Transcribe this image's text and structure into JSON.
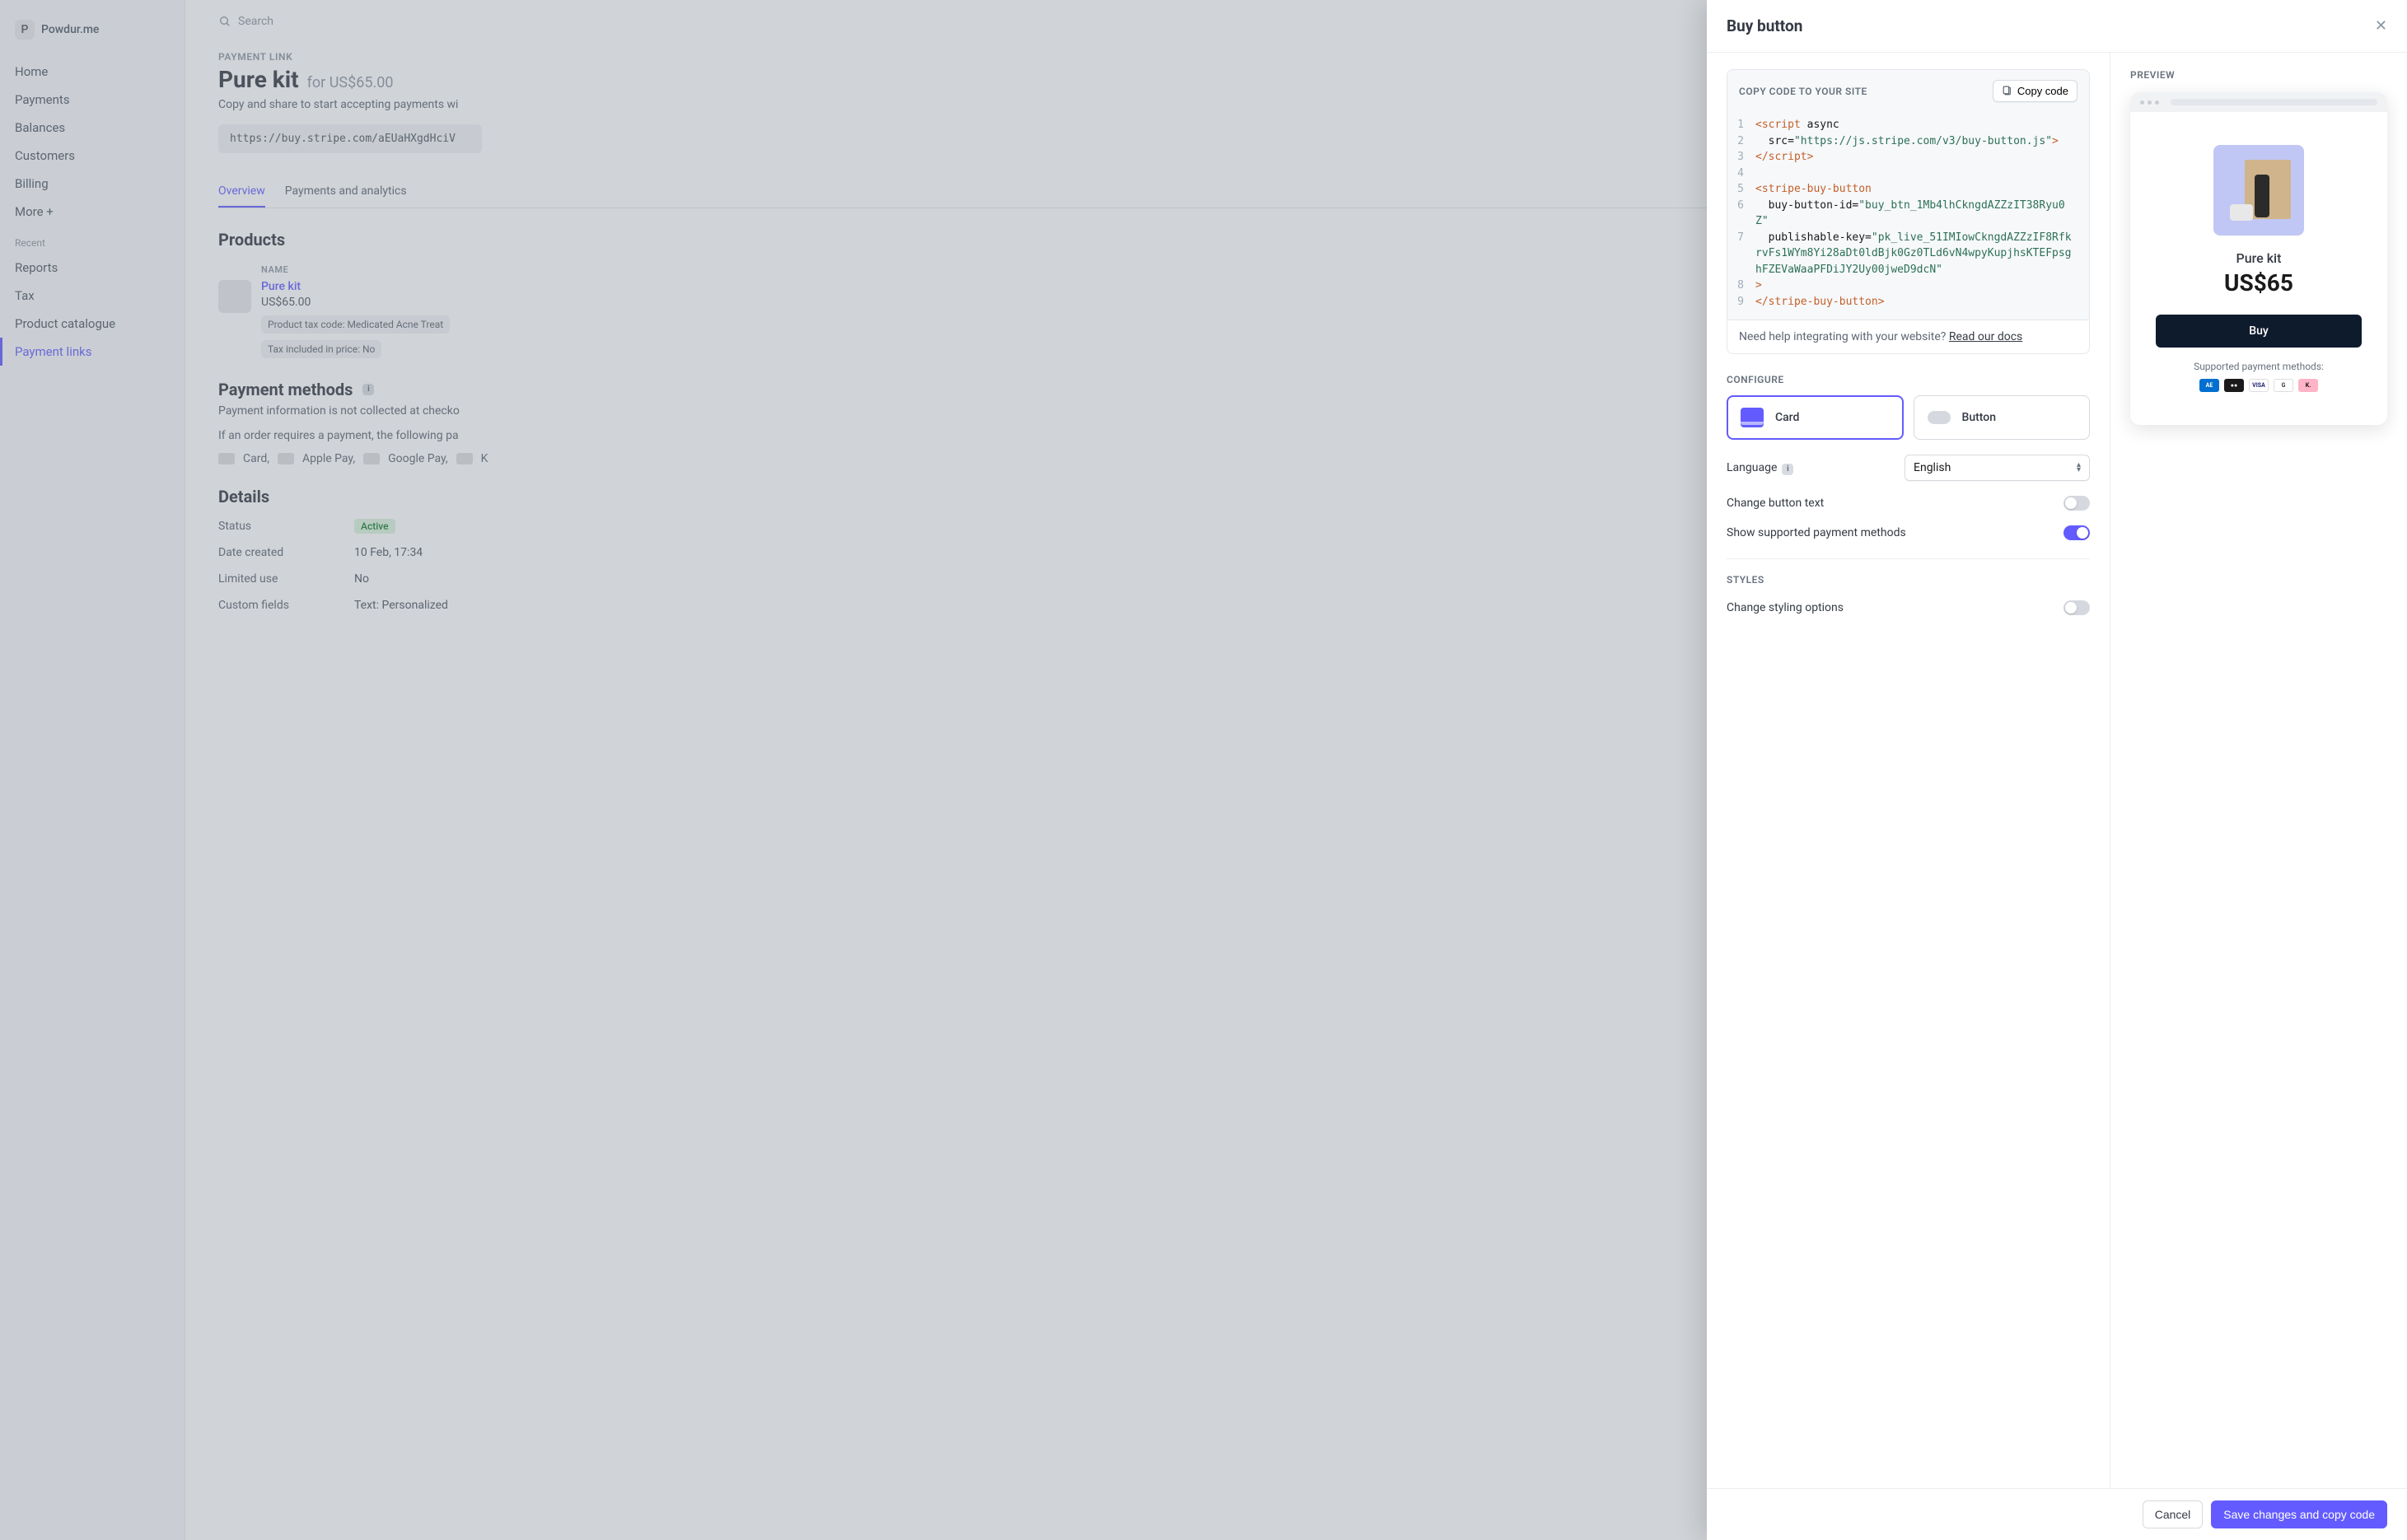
{
  "brand": {
    "logo_letter": "P",
    "name": "Powdur.me"
  },
  "search": {
    "placeholder": "Search"
  },
  "nav": {
    "items": [
      "Home",
      "Payments",
      "Balances",
      "Customers",
      "Billing",
      "More +"
    ],
    "recent_label": "Recent",
    "recent_items": [
      "Reports",
      "Tax",
      "Product catalogue",
      "Payment links"
    ]
  },
  "page": {
    "breadcrumb": "PAYMENT LINK",
    "title": "Pure kit",
    "title_suffix": "for US$65.00",
    "desc": "Copy and share to start accepting payments wi",
    "url": "https://buy.stripe.com/aEUaHXgdHciV",
    "tabs": [
      "Overview",
      "Payments and analytics"
    ],
    "products_heading": "Products",
    "table_header": "NAME",
    "product": {
      "name": "Pure kit",
      "price": "US$65.00",
      "tax_code": "Product tax code: Medicated Acne Treat",
      "tax_included": "Tax included in price: No"
    },
    "pm_heading": "Payment methods",
    "pm_desc1": "Payment information is not collected at checko",
    "pm_desc2": "If an order requires a payment, the following pa",
    "pm_list": [
      "Card,",
      "Apple Pay,",
      "Google Pay,",
      "K"
    ],
    "details_heading": "Details",
    "details": {
      "status_label": "Status",
      "status_value": "Active",
      "date_label": "Date created",
      "date_value": "10 Feb, 17:34",
      "limited_label": "Limited use",
      "limited_value": "No",
      "custom_label": "Custom fields",
      "custom_value": "Text: Personalized"
    }
  },
  "modal": {
    "title": "Buy button",
    "code_header": "COPY CODE TO YOUR SITE",
    "copy_button": "Copy code",
    "code": {
      "l1_a": "<script",
      "l1_b": " async",
      "l2_a": "  src=",
      "l2_b": "\"https://js.stripe.com/v3/buy-button.js\"",
      "l2_c": ">",
      "l3": "</script>",
      "l4": "",
      "l5": "<stripe-buy-button",
      "l6_a": "  buy-button-id=",
      "l6_b": "\"buy_btn_1Mb4lhCkngdAZZzIT38Ryu0Z\"",
      "l7_a": "  publishable-key=",
      "l7_b": "\"pk_live_51IMIowCkngdAZZzIF8RfkrvFs1WYm8Yi28aDt0ldBjk0Gz0TLd6vN4wpyKupjhsKTEFpsghFZEVaWaaPFDiJY2Uy00jweD9dcN\"",
      "l8": ">",
      "l9": "</stripe-buy-button>"
    },
    "help_text": "Need help integrating with your website? ",
    "help_link": "Read our docs",
    "configure_label": "CONFIGURE",
    "seg_card": "Card",
    "seg_button": "Button",
    "language_label": "Language",
    "language_value": "English",
    "change_text_label": "Change button text",
    "show_pm_label": "Show supported payment methods",
    "styles_label": "STYLES",
    "styling_label": "Change styling options",
    "cancel": "Cancel",
    "save": "Save changes and copy code",
    "preview_label": "PREVIEW",
    "preview": {
      "name": "Pure kit",
      "price": "US$65",
      "buy": "Buy",
      "spm": "Supported payment methods:"
    }
  }
}
